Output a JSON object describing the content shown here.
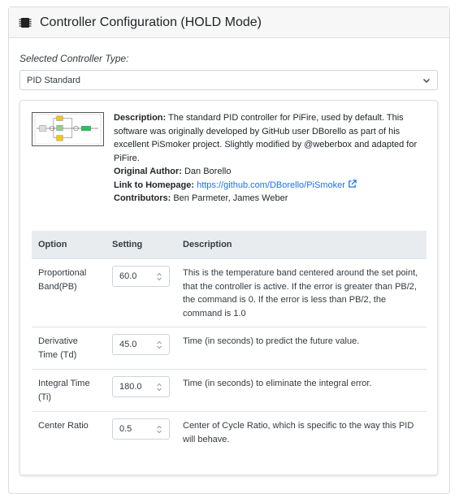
{
  "header": {
    "title": "Controller Configuration (HOLD Mode)",
    "icon": "chip-icon"
  },
  "controller": {
    "label": "Selected Controller Type:",
    "selected": "PID Standard"
  },
  "info": {
    "description_label": "Description:",
    "description": "The standard PID controller for PiFire, used by default. This software was originally developed by GitHub user DBorello as part of his excellent PiSmoker project. Slightly modified by @weberbox and adapted for PiFire.",
    "author_label": "Original Author:",
    "author": "Dan Borello",
    "homepage_label": "Link to Homepage:",
    "homepage": "https://github.com/DBorello/PiSmoker",
    "contributors_label": "Contributors:",
    "contributors": "Ben Parmeter, James Weber"
  },
  "table": {
    "headers": [
      "Option",
      "Setting",
      "Description"
    ],
    "rows": [
      {
        "option": "Proportional Band(PB)",
        "value": "60.0",
        "description": "This is the temperature band centered around the set point, that the controller is active. If the error is greater than PB/2, the command is 0. If the error is less than PB/2, the command is 1.0"
      },
      {
        "option": "Derivative Time (Td)",
        "value": "45.0",
        "description": "Time (in seconds) to predict the future value."
      },
      {
        "option": "Integral Time (Ti)",
        "value": "180.0",
        "description": "Time (in seconds) to eliminate the integral error."
      },
      {
        "option": "Center Ratio",
        "value": "0.5",
        "description": "Center of Cycle Ratio, which is specific to the way this PID will behave."
      }
    ]
  },
  "colors": {
    "link": "#1a73e8",
    "header_bg": "#f7f7f7",
    "table_head_bg": "#e9ecef"
  }
}
